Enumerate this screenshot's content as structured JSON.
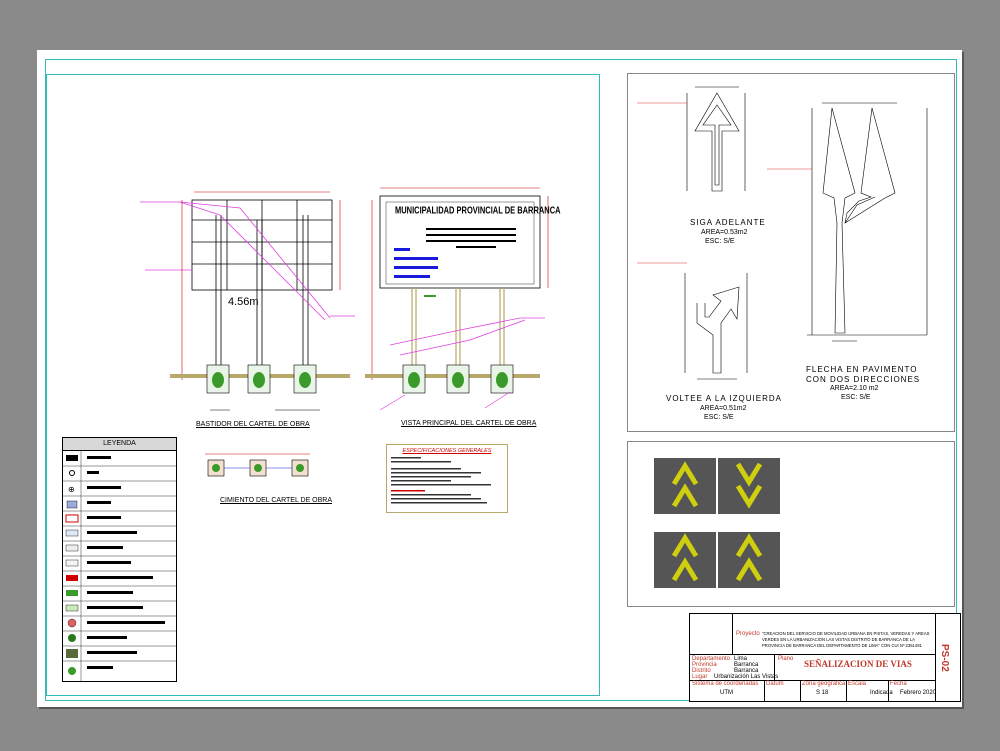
{
  "drawing": {
    "left_panel": {
      "dim_height": "4.56m",
      "views": {
        "frame_title": "BASTIDOR DEL CARTEL DE OBRA",
        "front_title": "VISTA PRINCIPAL DEL CARTEL DE OBRA",
        "foundation_title": "CIMIENTO DEL CARTEL DE OBRA",
        "sign_heading": "MUNICIPALIDAD PROVINCIAL DE BARRANCA"
      },
      "legend": {
        "title": "LEYENDA"
      },
      "specs": {
        "title": "ESPECIFICACIONES GENERALES"
      }
    },
    "right_panel": {
      "sign1": {
        "name": "SIGA ADELANTE",
        "area": "AREA=0.53m2",
        "scale": "ESC: S/E"
      },
      "sign2": {
        "name": "VOLTEE A LA IZQUIERDA",
        "area": "AREA=0.51m2",
        "scale": "ESC: S/E"
      },
      "sign3": {
        "name": "FLECHA EN PAVIMENTO CON DOS DIRECCIONES",
        "name_line1": "FLECHA EN PAVIMENTO",
        "name_line2": "CON DOS DIRECCIONES",
        "area": "AREA=2.10 m2",
        "scale": "ESC: S/E"
      }
    },
    "title_block": {
      "proyecto_label": "Proyecto",
      "proyecto_text_1": "\"CREACION DEL SERVICIO DE MOVILIDAD URBANA EN PISTAS, VEREDAS Y AREAS",
      "proyecto_text_2": "VERDES EN LA URBANIZACION LAS VISTAS DISTRITO DE BARRANCA DE LA",
      "proyecto_text_3": "PROVINCIA DE BARRANCA DEL DEPARTAMENTO DE LIMA\" CON CUI Nº 2351491",
      "dept_label": "Departamento",
      "dept_value": "Lima",
      "prov_label": "Provincia",
      "prov_value": "Barranca",
      "dist_label": "Distrito",
      "dist_value": "Barranca",
      "lugar_label": "Lugar",
      "lugar_value": "Urbanización Las Vistas",
      "plano_label": "Plano",
      "plano_value": "SEÑALIZACION DE VIAS",
      "coord_label": "Sistema de coordenadas",
      "coord_value": "UTM",
      "datum_label": "Datum",
      "datum_value": "",
      "zona_label": "Zona geografica",
      "zona_value": "S 18",
      "escala_label": "Escala",
      "escala_value": "Indicada",
      "fecha_label": "Fecha",
      "fecha_value": "Febrero  2020",
      "sheet_code": "PS-02"
    }
  },
  "colors": {
    "frame": "#33bbbb",
    "magenta": "#e040e0",
    "blue": "#1a1adf",
    "red": "#d00000",
    "olive": "#b8a86a",
    "green": "#3a9a2a",
    "yellow": "#d4d400",
    "asphalt": "#555555"
  }
}
